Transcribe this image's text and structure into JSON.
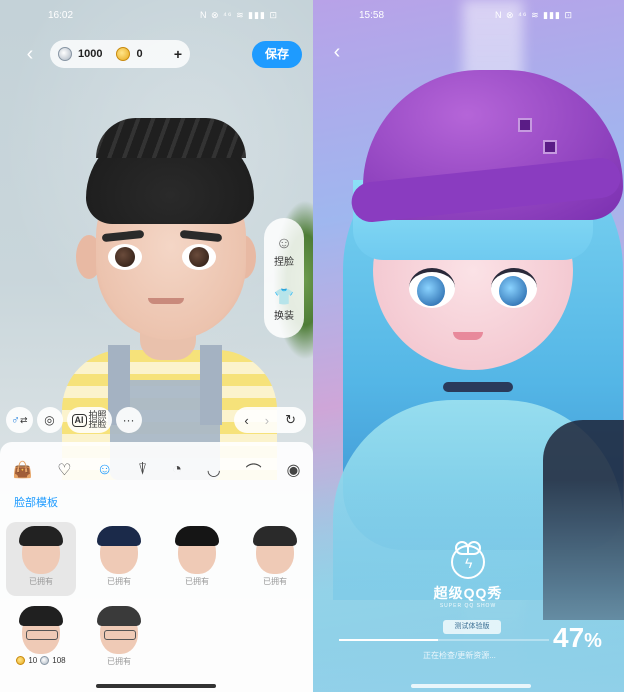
{
  "left": {
    "status": {
      "time": "16:02",
      "icons": "N ⊗ ⁴⁶ ≋ ▮▮▮ ⊡"
    },
    "back_icon": "chevron-left",
    "currency": {
      "silver": "1000",
      "gold": "0",
      "plus": "+"
    },
    "save_label": "保存",
    "side_actions": [
      {
        "icon": "face-shape-icon",
        "label": "捏脸"
      },
      {
        "icon": "shirt-icon",
        "label": "换装"
      }
    ],
    "toolbar": {
      "gender_icon": "♂",
      "ai_badge": "AI",
      "ai_label_1": "拍照",
      "ai_label_2": "捏脸",
      "more": "···",
      "undo_prev": "‹",
      "undo_next": "›",
      "reset": "↻"
    },
    "categories": [
      "bag",
      "heart",
      "face-outline",
      "pin",
      "helmet",
      "round-face",
      "brow",
      "eye"
    ],
    "section_title": "脸部模板",
    "templates": [
      {
        "label": "已拥有",
        "hair": "#222222",
        "glasses": false,
        "selected": true
      },
      {
        "label": "已拥有",
        "hair": "#1b2a4a",
        "glasses": false,
        "selected": false
      },
      {
        "label": "已拥有",
        "hair": "#151515",
        "glasses": false,
        "selected": false
      },
      {
        "label": "已拥有",
        "hair": "#2a2a2a",
        "glasses": false,
        "selected": false
      },
      {
        "label": "",
        "hair": "#202020",
        "glasses": true,
        "selected": false,
        "price_gold": "10",
        "price_silver": "108"
      },
      {
        "label": "已拥有",
        "hair": "#3a3a3a",
        "glasses": true,
        "selected": false
      }
    ]
  },
  "right": {
    "status": {
      "time": "15:58",
      "icons": "N ⊗ ⁴⁶ ≋ ▮▮▮ ⊡"
    },
    "back_icon": "chevron-left",
    "logo_title": "超级QQ秀",
    "logo_sub": "SUPER QQ SHOW",
    "trial_badge": "测试体验版",
    "progress": 0.47,
    "percent_value": "47",
    "percent_sign": "%",
    "loading_text": "正在检查/更新资源..."
  },
  "colors": {
    "accent": "#1e9bff"
  }
}
